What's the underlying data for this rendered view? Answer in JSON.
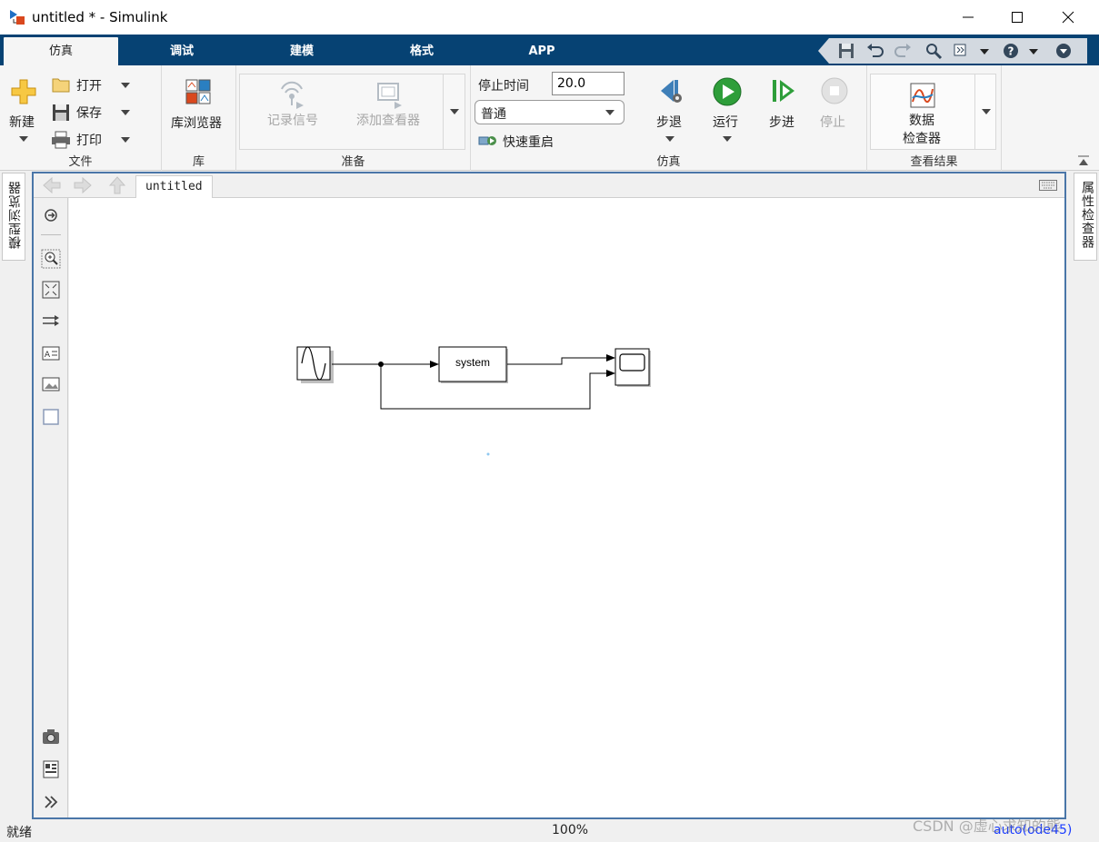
{
  "window": {
    "title": "untitled * - Simulink"
  },
  "tabs": [
    "仿真",
    "调试",
    "建模",
    "格式",
    "APP"
  ],
  "ribbon": {
    "file": {
      "new_label": "新建",
      "open_label": "打开",
      "save_label": "保存",
      "print_label": "打印",
      "group_label": "文件"
    },
    "library": {
      "browser_label": "库浏览器",
      "group_label": "库"
    },
    "prepare": {
      "log_signals_label": "记录信号",
      "add_viewer_label": "添加查看器",
      "group_label": "准备"
    },
    "simulate": {
      "stop_time_label": "停止时间",
      "stop_time_value": "20.0",
      "mode_value": "普通",
      "fast_restart_label": "快速重启",
      "step_back_label": "步退",
      "run_label": "运行",
      "step_forward_label": "步进",
      "stop_label": "停止",
      "group_label": "仿真"
    },
    "review": {
      "data_inspector_line1": "数据",
      "data_inspector_line2": "检查器",
      "group_label": "查看结果"
    }
  },
  "side_tabs": {
    "left": "模型浏览器",
    "right": "属性检查器"
  },
  "editor": {
    "breadcrumb": "untitled"
  },
  "diagram": {
    "blocks": {
      "sine": "sine-wave-block",
      "subsystem": "system",
      "scope": "scope-block"
    }
  },
  "status": {
    "left": "就绪",
    "zoom": "100%",
    "solver": "auto(ode45)"
  },
  "watermark": "CSDN @虚心求知的熊",
  "colors": {
    "tab_bar": "#064273",
    "run_green": "#2e9e3a",
    "editor_border": "#4a76a8",
    "solver_blue": "#1a3cff"
  }
}
